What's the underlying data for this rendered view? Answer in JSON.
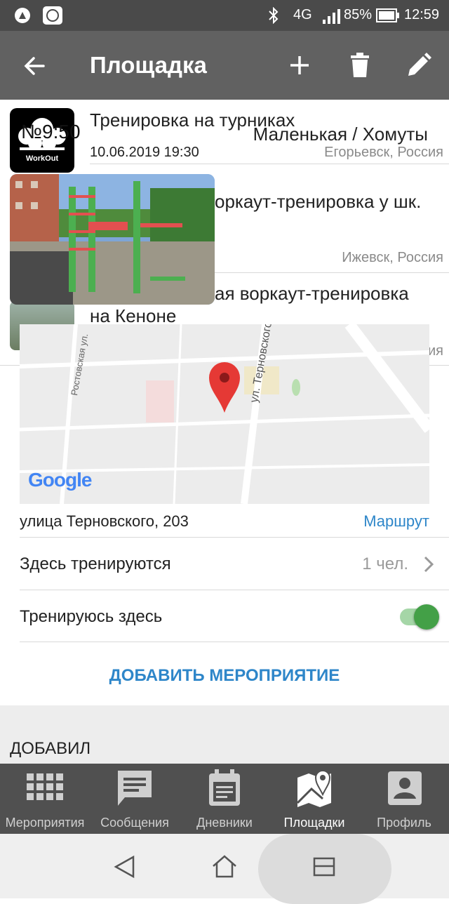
{
  "status_bar": {
    "signal": "4G",
    "battery": "85%",
    "time": "12:59"
  },
  "app_bar": {
    "title": "Площадка"
  },
  "events": [
    {
      "title": "Тренировка на турниках",
      "date": "10.06.2019 19:30",
      "place": "Маленькая / Хомуты",
      "city": "Егорьевск, Россия",
      "badge": "№9:50",
      "logo_text": "WorkOut"
    },
    {
      "title": "оркаут-тренировка у шк.",
      "city": "Ижевск, Россия"
    },
    {
      "title_line1": "ая воркаут-тренировка",
      "title_line2": "на Кеноне",
      "city": "ия"
    }
  ],
  "map": {
    "street_label_1": "ул. Терновского",
    "street_label_2": "Ростовская ул.",
    "brand": "Google"
  },
  "address": {
    "text": "улица Терновского, 203",
    "route_label": "Маршрут"
  },
  "training_here": {
    "label": "Здесь тренируются",
    "count": "1 чел."
  },
  "i_train_here": {
    "label": "Тренируюсь здесь",
    "toggle_on": true
  },
  "add_event_label": "ДОБАВИТЬ МЕРОПРИЯТИЕ",
  "added_by_header": "ДОБАВИЛ",
  "bottom_nav": [
    {
      "label": "Мероприятия",
      "icon": "grid-icon"
    },
    {
      "label": "Сообщения",
      "icon": "message-icon"
    },
    {
      "label": "Дневники",
      "icon": "diary-icon"
    },
    {
      "label": "Площадки",
      "icon": "map-pin-icon",
      "active": true
    },
    {
      "label": "Профиль",
      "icon": "profile-icon"
    }
  ],
  "colors": {
    "accent": "#2e86c9",
    "toggle": "#43a047",
    "app_bar": "#616161",
    "status_bar": "#4a4a4a"
  }
}
